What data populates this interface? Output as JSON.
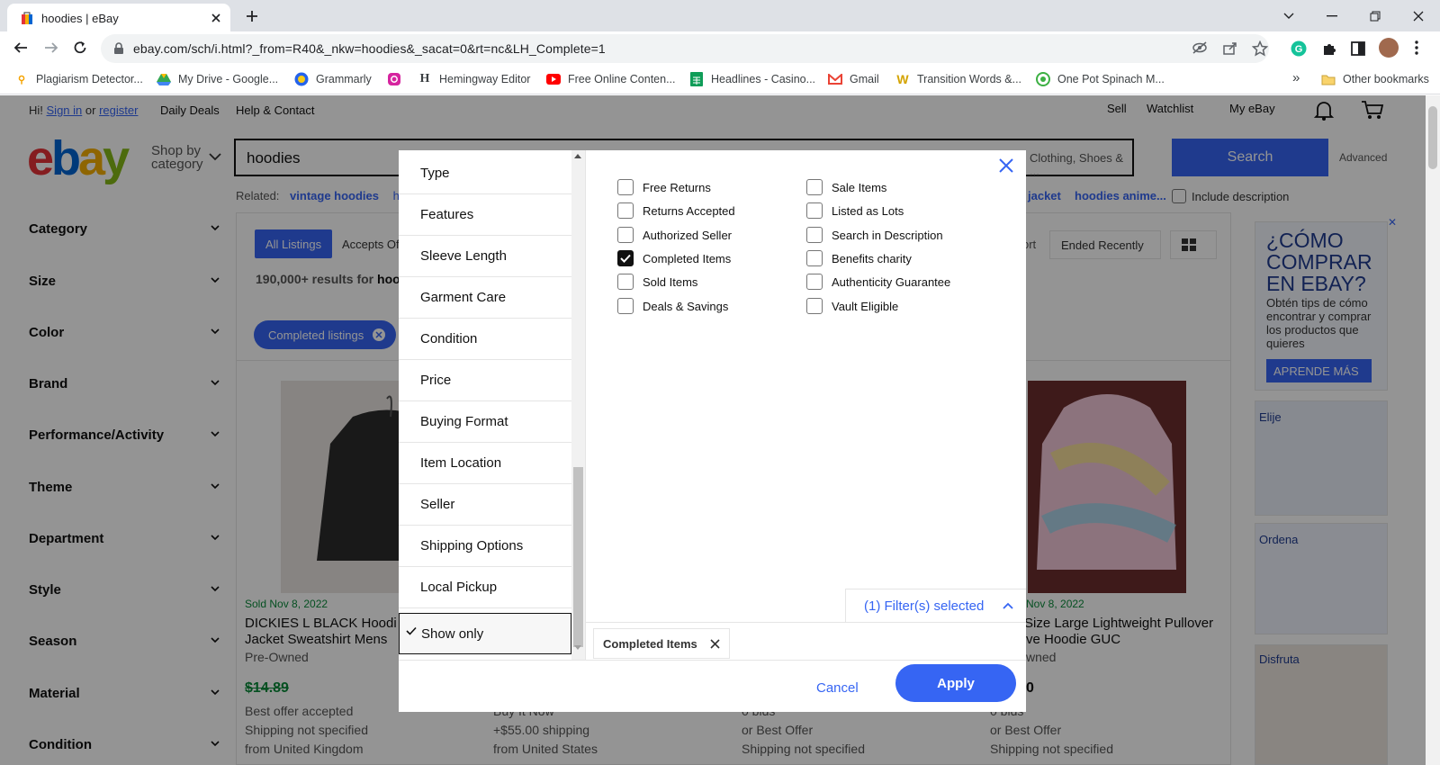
{
  "browser": {
    "tab_title": "hoodies | eBay",
    "url": "ebay.com/sch/i.html?_from=R40&_nkw=hoodies&_sacat=0&rt=nc&LH_Complete=1",
    "bookmarks": [
      {
        "label": "Plagiarism Detector...",
        "icon": "plagiarism-icon"
      },
      {
        "label": "My Drive - Google...",
        "icon": "google-drive-icon"
      },
      {
        "label": "Grammarly",
        "icon": "grammarly-icon"
      },
      {
        "label": "",
        "icon": "instagram-icon"
      },
      {
        "label": "Hemingway Editor",
        "icon": "hemingway-icon"
      },
      {
        "label": "Free Online Conten...",
        "icon": "youtube-icon"
      },
      {
        "label": "Headlines - Casino...",
        "icon": "sheets-icon"
      },
      {
        "label": "Gmail",
        "icon": "gmail-icon"
      },
      {
        "label": "Transition Words &...",
        "icon": "w-icon"
      },
      {
        "label": "One Pot Spinach M...",
        "icon": "green-circle-icon"
      }
    ],
    "other_bookmarks": "Other bookmarks"
  },
  "ebay": {
    "greeting": "Hi!",
    "sign_in": "Sign in",
    "or": "or",
    "register": "register",
    "daily_deals": "Daily Deals",
    "help_contact": "Help & Contact",
    "sell": "Sell",
    "watchlist": "Watchlist",
    "my_ebay": "My eBay",
    "shop_by": "Shop by",
    "category": "category",
    "search_value": "hoodies",
    "category_select": "Clothing, Shoes & ...",
    "search_button": "Search",
    "advanced": "Advanced",
    "related_label": "Related:",
    "related_1": "vintage hoodies",
    "related_2": "hoo",
    "related_3": "jacket",
    "related_4": "hoodies anime...",
    "include_description": "Include description",
    "sidebar": [
      "Category",
      "Size",
      "Color",
      "Brand",
      "Performance/Activity",
      "Theme",
      "Department",
      "Style",
      "Season",
      "Material",
      "Condition"
    ],
    "all_listings": "All Listings",
    "accepts_offers": "Accepts Of",
    "sort_label": "ort",
    "sort_value": "Ended Recently",
    "results": "190,000+ results for",
    "results_q": "hoo",
    "completed_chip": "Completed listings",
    "products": [
      {
        "sold": "Sold Nov 8, 2022",
        "title1": "DICKIES L BLACK Hoodi",
        "title2": "Jacket Sweatshirt Mens",
        "cond": "Pre-Owned",
        "price": "$14.89",
        "l1": "Best offer accepted",
        "l2": "Shipping not specified",
        "l3": "from United Kingdom"
      },
      {
        "l1": "Buy It Now",
        "l2": "+$55.00 shipping",
        "l3": "from United States"
      },
      {
        "l1": "0 bids",
        "l2": "or Best Offer",
        "l3": "Shipping not specified"
      },
      {
        "sold": "Nov 8, 2022",
        "title1": "Size Large Lightweight Pullover",
        "title2": "ve Hoodie GUC",
        "cond": "wned",
        "price": "0",
        "l1": "0 bids",
        "l2": "or Best Offer",
        "l3": "Shipping not specified"
      }
    ],
    "ad": {
      "title": "¿CÓMO COMPRAR EN EBAY?",
      "body": "Obtén tips de cómo encontrar y comprar los productos que quieres",
      "cta": "APRENDE MÁS",
      "card1": "Elije",
      "card2": "Ordena",
      "card3": "Disfruta"
    }
  },
  "dialog": {
    "categories": [
      "Type",
      "Features",
      "Sleeve Length",
      "Garment Care",
      "Condition",
      "Price",
      "Buying Format",
      "Item Location",
      "Seller",
      "Shipping Options",
      "Local Pickup",
      "Show only"
    ],
    "selected_category": "Show only",
    "options_left": [
      {
        "label": "Free Returns",
        "checked": false
      },
      {
        "label": "Returns Accepted",
        "checked": false
      },
      {
        "label": "Authorized Seller",
        "checked": false
      },
      {
        "label": "Completed Items",
        "checked": true
      },
      {
        "label": "Sold Items",
        "checked": false
      },
      {
        "label": "Deals & Savings",
        "checked": false
      }
    ],
    "options_right": [
      {
        "label": "Sale Items",
        "checked": false
      },
      {
        "label": "Listed as Lots",
        "checked": false
      },
      {
        "label": "Search in Description",
        "checked": false
      },
      {
        "label": "Benefits charity",
        "checked": false
      },
      {
        "label": "Authenticity Guarantee",
        "checked": false
      },
      {
        "label": "Vault Eligible",
        "checked": false
      }
    ],
    "filters_selected": "(1) Filter(s) selected",
    "chip": "Completed Items",
    "cancel": "Cancel",
    "apply": "Apply",
    "accent": "#3665f3"
  }
}
